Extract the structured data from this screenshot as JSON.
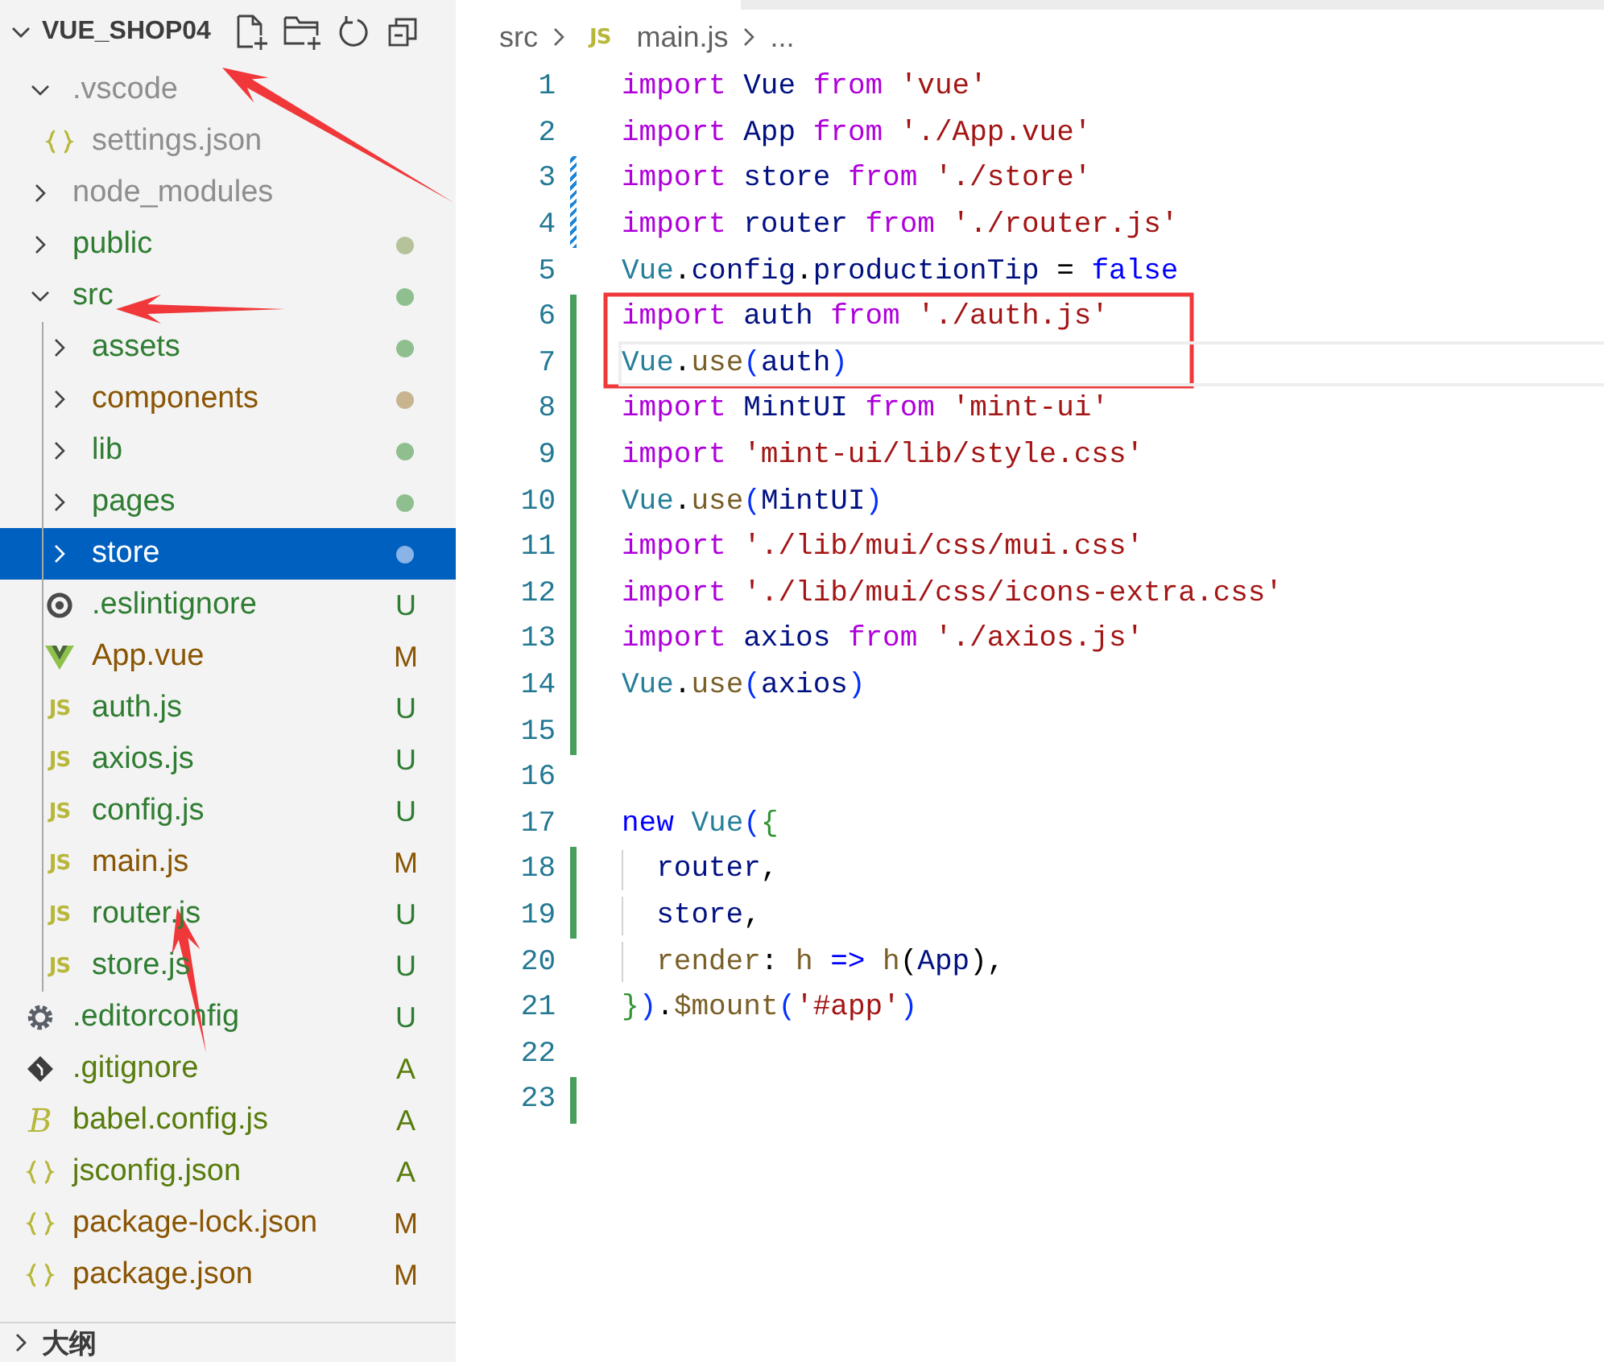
{
  "explorer": {
    "title": "VUE_SHOP04",
    "expanded": true,
    "items": [
      {
        "label": ".vscode",
        "kind": "folder",
        "color": "#8e8e90",
        "expanded": true,
        "selected": false,
        "children": [
          {
            "label": "settings.json",
            "kind": "json",
            "color": "#8e8e90",
            "selected": false
          }
        ]
      },
      {
        "label": "node_modules",
        "kind": "folder",
        "color": "#8e8e90",
        "expanded": false,
        "selected": false
      },
      {
        "label": "public",
        "kind": "folder",
        "color": "#2f7d32",
        "expanded": false,
        "selected": false,
        "dot": {
          "color": "#b5c29a"
        }
      },
      {
        "label": "src",
        "kind": "folder",
        "color": "#2f7d32",
        "expanded": true,
        "selected": false,
        "dot": {
          "color": "#8fbf8f"
        },
        "children": [
          {
            "label": "assets",
            "kind": "folder",
            "color": "#2f7d32",
            "expanded": false,
            "selected": false,
            "dot": {
              "color": "#8fbf8f"
            }
          },
          {
            "label": "components",
            "kind": "folder",
            "color": "#895503",
            "expanded": false,
            "selected": false,
            "dot": {
              "color": "#c8b48f"
            }
          },
          {
            "label": "lib",
            "kind": "folder",
            "color": "#2f7d32",
            "expanded": false,
            "selected": false,
            "dot": {
              "color": "#8fbf8f"
            }
          },
          {
            "label": "pages",
            "kind": "folder",
            "color": "#2f7d32",
            "expanded": false,
            "selected": false,
            "dot": {
              "color": "#8fbf8f"
            }
          },
          {
            "label": "store",
            "kind": "folder",
            "color": "#ffffff",
            "expanded": false,
            "selected": true,
            "dot": {
              "color": "#8ab4e8"
            }
          },
          {
            "label": ".eslintignore",
            "kind": "eslint",
            "color": "#2f7d32",
            "selected": false,
            "badge": "U"
          },
          {
            "label": "App.vue",
            "kind": "vue",
            "color": "#895503",
            "selected": false,
            "badge": "M"
          },
          {
            "label": "auth.js",
            "kind": "js",
            "icon_text": "JS",
            "color": "#2f7d32",
            "selected": false,
            "badge": "U"
          },
          {
            "label": "axios.js",
            "kind": "js",
            "icon_text": "JS",
            "color": "#2f7d32",
            "selected": false,
            "badge": "U"
          },
          {
            "label": "config.js",
            "kind": "js",
            "icon_text": "JS",
            "color": "#2f7d32",
            "selected": false,
            "badge": "U"
          },
          {
            "label": "main.js",
            "kind": "js",
            "icon_text": "JS",
            "color": "#895503",
            "selected": false,
            "badge": "M"
          },
          {
            "label": "router.js",
            "kind": "js",
            "icon_text": "JS",
            "color": "#2f7d32",
            "selected": false,
            "badge": "U"
          },
          {
            "label": "store.js",
            "kind": "js",
            "icon_text": "JS",
            "color": "#2f7d32",
            "selected": false,
            "badge": "U"
          }
        ]
      },
      {
        "label": ".editorconfig",
        "kind": "config",
        "color": "#2f7d32",
        "selected": false,
        "badge": "U"
      },
      {
        "label": ".gitignore",
        "kind": "git",
        "color": "#587c0c",
        "selected": false,
        "badge": "A"
      },
      {
        "label": "babel.config.js",
        "kind": "babel",
        "icon_text": "B",
        "color": "#587c0c",
        "selected": false,
        "badge": "A"
      },
      {
        "label": "jsconfig.json",
        "kind": "json",
        "color": "#587c0c",
        "selected": false,
        "badge": "A"
      },
      {
        "label": "package-lock.json",
        "kind": "json",
        "color": "#895503",
        "selected": false,
        "badge": "M"
      },
      {
        "label": "package.json",
        "kind": "json",
        "color": "#895503",
        "selected": false,
        "badge": "M"
      }
    ]
  },
  "outline": {
    "title": "大纲",
    "expanded": false
  },
  "editor": {
    "breadcrumb": [
      {
        "label": "src"
      },
      {
        "label": "main.js",
        "icon_text": "JS"
      },
      {
        "label": "..."
      }
    ],
    "lines": [
      {
        "number": "1",
        "current": false,
        "tokens": [
          {
            "text": "import ",
            "kind": "keyword"
          },
          {
            "text": "Vue ",
            "kind": "variable"
          },
          {
            "text": "from ",
            "kind": "keyword"
          },
          {
            "text": "'vue'",
            "kind": "string"
          }
        ]
      },
      {
        "number": "2",
        "current": false,
        "tokens": [
          {
            "text": "import ",
            "kind": "keyword"
          },
          {
            "text": "App ",
            "kind": "variable"
          },
          {
            "text": "from ",
            "kind": "keyword"
          },
          {
            "text": "'./App.vue'",
            "kind": "string"
          }
        ]
      },
      {
        "number": "3",
        "current": false,
        "change": {
          "kind": "modified"
        },
        "tokens": [
          {
            "text": "import ",
            "kind": "keyword"
          },
          {
            "text": "store ",
            "kind": "variable"
          },
          {
            "text": "from ",
            "kind": "keyword"
          },
          {
            "text": "'./store'",
            "kind": "string"
          }
        ]
      },
      {
        "number": "4",
        "current": false,
        "change": {
          "kind": "modified"
        },
        "tokens": [
          {
            "text": "import ",
            "kind": "keyword"
          },
          {
            "text": "router ",
            "kind": "variable"
          },
          {
            "text": "from ",
            "kind": "keyword"
          },
          {
            "text": "'./router.js'",
            "kind": "string"
          }
        ]
      },
      {
        "number": "5",
        "current": false,
        "tokens": [
          {
            "text": "Vue",
            "kind": "class"
          },
          {
            "text": ".",
            "kind": "plain"
          },
          {
            "text": "config",
            "kind": "variable"
          },
          {
            "text": ".",
            "kind": "plain"
          },
          {
            "text": "productionTip",
            "kind": "variable"
          },
          {
            "text": " = ",
            "kind": "plain"
          },
          {
            "text": "false",
            "kind": "constant"
          }
        ]
      },
      {
        "number": "6",
        "current": false,
        "change": {
          "kind": "added"
        },
        "tokens": [
          {
            "text": "import ",
            "kind": "keyword"
          },
          {
            "text": "auth ",
            "kind": "variable"
          },
          {
            "text": "from ",
            "kind": "keyword"
          },
          {
            "text": "'./auth.js'",
            "kind": "string"
          }
        ]
      },
      {
        "number": "7",
        "current": true,
        "change": {
          "kind": "added"
        },
        "tokens": [
          {
            "text": "Vue",
            "kind": "class"
          },
          {
            "text": ".",
            "kind": "plain"
          },
          {
            "text": "use",
            "kind": "function"
          },
          {
            "text": "(",
            "kind": "bracket"
          },
          {
            "text": "auth",
            "kind": "variable"
          },
          {
            "text": ")",
            "kind": "bracket"
          }
        ]
      },
      {
        "number": "8",
        "current": false,
        "change": {
          "kind": "added"
        },
        "tokens": [
          {
            "text": "import ",
            "kind": "keyword"
          },
          {
            "text": "MintUI ",
            "kind": "variable"
          },
          {
            "text": "from ",
            "kind": "keyword"
          },
          {
            "text": "'mint-ui'",
            "kind": "string"
          }
        ]
      },
      {
        "number": "9",
        "current": false,
        "change": {
          "kind": "added"
        },
        "tokens": [
          {
            "text": "import ",
            "kind": "keyword"
          },
          {
            "text": "'mint-ui/lib/style.css'",
            "kind": "string"
          }
        ]
      },
      {
        "number": "10",
        "current": false,
        "change": {
          "kind": "added"
        },
        "tokens": [
          {
            "text": "Vue",
            "kind": "class"
          },
          {
            "text": ".",
            "kind": "plain"
          },
          {
            "text": "use",
            "kind": "function"
          },
          {
            "text": "(",
            "kind": "bracket"
          },
          {
            "text": "MintUI",
            "kind": "variable"
          },
          {
            "text": ")",
            "kind": "bracket"
          }
        ]
      },
      {
        "number": "11",
        "current": false,
        "change": {
          "kind": "added"
        },
        "tokens": [
          {
            "text": "import ",
            "kind": "keyword"
          },
          {
            "text": "'./lib/mui/css/mui.css'",
            "kind": "string"
          }
        ]
      },
      {
        "number": "12",
        "current": false,
        "change": {
          "kind": "added"
        },
        "tokens": [
          {
            "text": "import ",
            "kind": "keyword"
          },
          {
            "text": "'./lib/mui/css/icons-extra.css'",
            "kind": "string"
          }
        ]
      },
      {
        "number": "13",
        "current": false,
        "change": {
          "kind": "added"
        },
        "tokens": [
          {
            "text": "import ",
            "kind": "keyword"
          },
          {
            "text": "axios ",
            "kind": "variable"
          },
          {
            "text": "from ",
            "kind": "keyword"
          },
          {
            "text": "'./axios.js'",
            "kind": "string"
          }
        ]
      },
      {
        "number": "14",
        "current": false,
        "change": {
          "kind": "added"
        },
        "tokens": [
          {
            "text": "Vue",
            "kind": "class"
          },
          {
            "text": ".",
            "kind": "plain"
          },
          {
            "text": "use",
            "kind": "function"
          },
          {
            "text": "(",
            "kind": "bracket"
          },
          {
            "text": "axios",
            "kind": "variable"
          },
          {
            "text": ")",
            "kind": "bracket"
          }
        ]
      },
      {
        "number": "15",
        "current": false,
        "change": {
          "kind": "added"
        }
      },
      {
        "number": "16",
        "current": false
      },
      {
        "number": "17",
        "current": false,
        "tokens": [
          {
            "text": "new ",
            "kind": "constant"
          },
          {
            "text": "Vue",
            "kind": "class"
          },
          {
            "text": "(",
            "kind": "bracket"
          },
          {
            "text": "{",
            "kind": "brace"
          }
        ]
      },
      {
        "number": "18",
        "current": false,
        "change": {
          "kind": "added"
        },
        "indent_guide": true,
        "tokens": [
          {
            "text": "router",
            "kind": "variable"
          },
          {
            "text": ",",
            "kind": "plain"
          }
        ]
      },
      {
        "number": "19",
        "current": false,
        "change": {
          "kind": "added"
        },
        "indent_guide": true,
        "tokens": [
          {
            "text": "store",
            "kind": "variable"
          },
          {
            "text": ",",
            "kind": "plain"
          }
        ]
      },
      {
        "number": "20",
        "current": false,
        "indent_guide": true,
        "tokens": [
          {
            "text": "render",
            "kind": "function"
          },
          {
            "text": ": ",
            "kind": "plain"
          },
          {
            "text": "h ",
            "kind": "function"
          },
          {
            "text": "=> ",
            "kind": "constant"
          },
          {
            "text": "h",
            "kind": "function"
          },
          {
            "text": "(",
            "kind": "plain"
          },
          {
            "text": "App",
            "kind": "variable"
          },
          {
            "text": "),",
            "kind": "plain"
          }
        ]
      },
      {
        "number": "21",
        "current": false,
        "tokens": [
          {
            "text": "}",
            "kind": "brace"
          },
          {
            "text": ")",
            "kind": "bracket"
          },
          {
            "text": ".",
            "kind": "plain"
          },
          {
            "text": "$mount",
            "kind": "function"
          },
          {
            "text": "(",
            "kind": "bracket"
          },
          {
            "text": "'#app'",
            "kind": "string"
          },
          {
            "text": ")",
            "kind": "bracket"
          }
        ]
      },
      {
        "number": "22",
        "current": false
      },
      {
        "number": "23",
        "current": false,
        "change": {
          "kind": "added"
        }
      }
    ]
  },
  "annotations": [
    {
      "kind": "arrow"
    },
    {
      "kind": "arrow"
    },
    {
      "kind": "arrow"
    },
    {
      "kind": "box"
    }
  ]
}
